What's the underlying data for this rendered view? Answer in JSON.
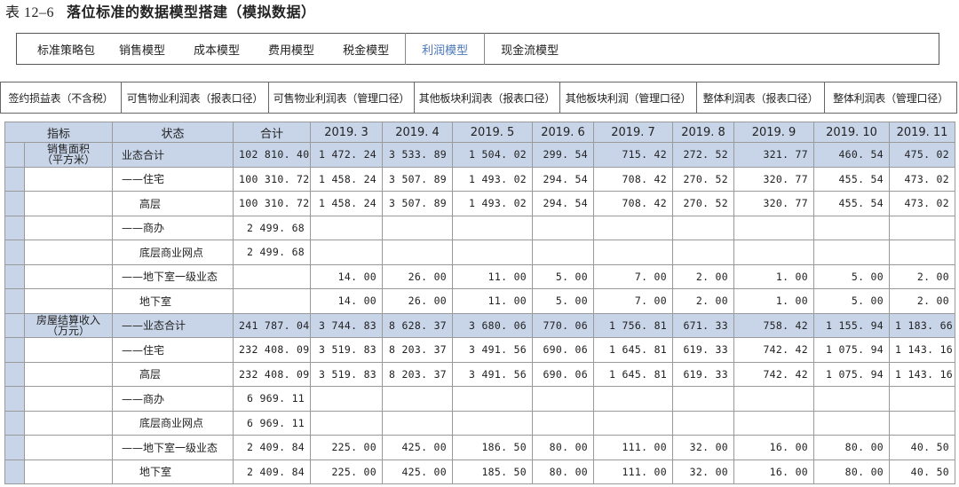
{
  "caption": {
    "number": "表 12–6",
    "title": "落位标准的数据模型搭建（模拟数据）"
  },
  "tabs": [
    {
      "label": "标准策略包",
      "active": false
    },
    {
      "label": "销售模型",
      "active": false
    },
    {
      "label": "成本模型",
      "active": false
    },
    {
      "label": "费用模型",
      "active": false
    },
    {
      "label": "税金模型",
      "active": false
    },
    {
      "label": "利润模型",
      "active": true
    },
    {
      "label": "现金流模型",
      "active": false
    }
  ],
  "subtabs": [
    "签约损益表（不含税）",
    "可售物业利润表（报表口径）",
    "可售物业利润表（管理口径）",
    "其他板块利润表（报表口径）",
    "其他板块利润（管理口径）",
    "整体利润表（报表口径）",
    "整体利润表（管理口径）"
  ],
  "table": {
    "headers": [
      "指标",
      "状态",
      "合计",
      "2019. 3",
      "2019. 4",
      "2019. 5",
      "2019. 6",
      "2019. 7",
      "2019. 8",
      "2019. 9",
      "2019. 10",
      "2019. 11"
    ],
    "groups": [
      {
        "indicator": "销售面积（平方米）",
        "indicator_lines": [
          "销售面积",
          "（平方米）"
        ],
        "rows": [
          {
            "status": "业态合计",
            "cells": [
              "102 810. 40",
              "1 472. 24",
              "3 533. 89",
              "1 504. 02",
              "299. 54",
              "715. 42",
              "272. 52",
              "321. 77",
              "460. 54",
              "475. 02"
            ],
            "sum": true
          },
          {
            "status": "——住宅",
            "cells": [
              "100 310. 72",
              "1 458. 24",
              "3 507. 89",
              "1 493. 02",
              "294. 54",
              "708. 42",
              "270. 52",
              "320. 77",
              "455. 54",
              "473. 02"
            ]
          },
          {
            "status": "高层",
            "cells": [
              "100 310. 72",
              "1 458. 24",
              "3 507. 89",
              "1 493. 02",
              "294. 54",
              "708. 42",
              "270. 52",
              "320. 77",
              "455. 54",
              "473. 02"
            ],
            "indent": true
          },
          {
            "status": "——商办",
            "cells": [
              "2 499. 68",
              "",
              "",
              "",
              "",
              "",
              "",
              "",
              "",
              ""
            ]
          },
          {
            "status": "底层商业网点",
            "cells": [
              "2 499. 68",
              "",
              "",
              "",
              "",
              "",
              "",
              "",
              "",
              ""
            ],
            "indent": true
          },
          {
            "status": "——地下室一级业态",
            "cells": [
              "",
              "14. 00",
              "26. 00",
              "11. 00",
              "5. 00",
              "7. 00",
              "2. 00",
              "1. 00",
              "5. 00",
              "2. 00"
            ]
          },
          {
            "status": "地下室",
            "cells": [
              "",
              "14. 00",
              "26. 00",
              "11. 00",
              "5. 00",
              "7. 00",
              "2. 00",
              "1. 00",
              "5. 00",
              "2. 00"
            ],
            "indent": true
          }
        ]
      },
      {
        "indicator": "房屋结算收入（万元）",
        "indicator_lines": [
          "房屋结算收入",
          "（万元）"
        ],
        "rows": [
          {
            "status": "——业态合计",
            "cells": [
              "241 787. 04",
              "3 744. 83",
              "8 628. 37",
              "3 680. 06",
              "770. 06",
              "1 756. 81",
              "671. 33",
              "758. 42",
              "1 155. 94",
              "1 183. 66"
            ],
            "sum": true
          },
          {
            "status": "——住宅",
            "cells": [
              "232 408. 09",
              "3 519. 83",
              "8 203. 37",
              "3 491. 56",
              "690. 06",
              "1 645. 81",
              "619. 33",
              "742. 42",
              "1 075. 94",
              "1 143. 16"
            ]
          },
          {
            "status": "高层",
            "cells": [
              "232 408. 09",
              "3 519. 83",
              "8 203. 37",
              "3 491. 56",
              "690. 06",
              "1 645. 81",
              "619. 33",
              "742. 42",
              "1 075. 94",
              "1 143. 16"
            ],
            "indent": true
          },
          {
            "status": "——商办",
            "cells": [
              "6 969. 11",
              "",
              "",
              "",
              "",
              "",
              "",
              "",
              "",
              ""
            ]
          },
          {
            "status": "底层商业网点",
            "cells": [
              "6 969. 11",
              "",
              "",
              "",
              "",
              "",
              "",
              "",
              "",
              ""
            ],
            "indent": true
          },
          {
            "status": "——地下室一级业态",
            "cells": [
              "2 409. 84",
              "225. 00",
              "425. 00",
              "186. 50",
              "80. 00",
              "111. 00",
              "32. 00",
              "16. 00",
              "80. 00",
              "40. 50"
            ]
          },
          {
            "status": "地下室",
            "cells": [
              "2 409. 84",
              "225. 00",
              "425. 00",
              "185. 50",
              "80. 00",
              "111. 00",
              "32. 00",
              "16. 00",
              "80. 00",
              "40. 50"
            ],
            "indent": true
          }
        ]
      }
    ]
  }
}
